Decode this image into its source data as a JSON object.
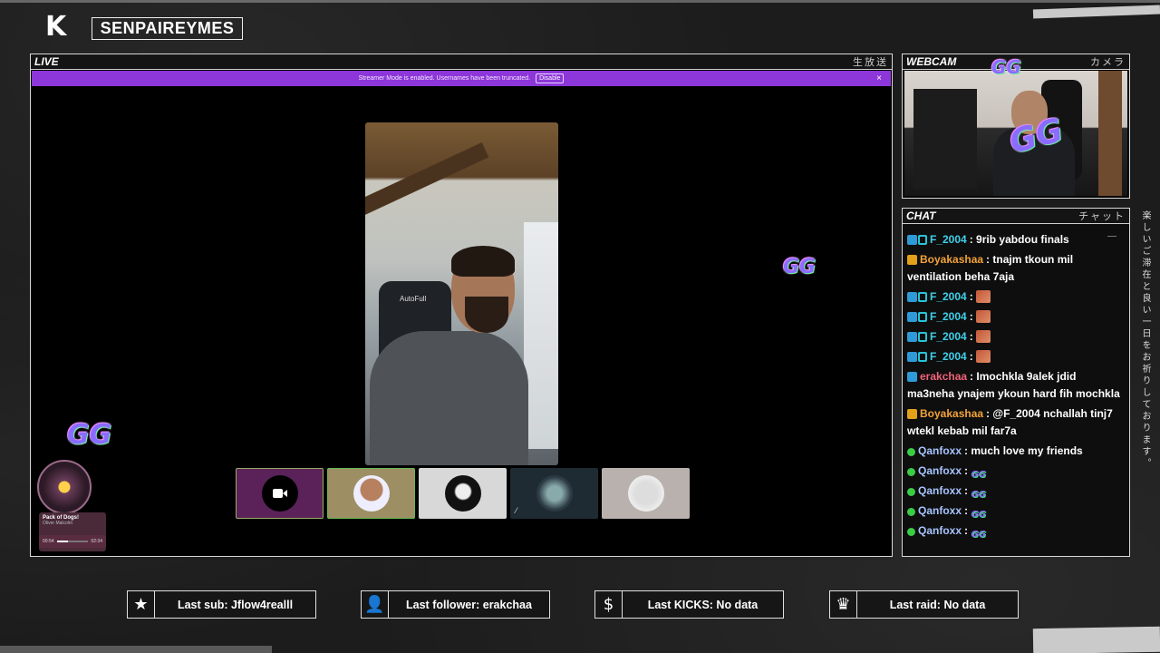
{
  "channel": {
    "name": "SENPAIREYMES"
  },
  "live": {
    "title": "LIVE",
    "jp": "生放送",
    "banner": {
      "text": "Streamer Mode is enabled. Usernames have been truncated.",
      "button": "Disable",
      "close": "×"
    },
    "video": {
      "chair_brand": "AutoFull"
    },
    "music": {
      "title": "Pack of Dogs!",
      "artist": "Oliver Malcolm",
      "elapsed": "00:54",
      "total": "02:34",
      "progress": 0.35
    },
    "gg_label": "GG"
  },
  "webcam": {
    "title": "WEBCAM",
    "jp": "カメラ"
  },
  "chat": {
    "title": "CHAT",
    "jp": "チャット",
    "messages": [
      {
        "user": "F_2004",
        "color": "#3fd0ea",
        "badges": [
          "blue",
          "box"
        ],
        "text": "9rib yabdou finals"
      },
      {
        "user": "Boyakashaa",
        "color": "#f2a33a",
        "badges": [
          "gold"
        ],
        "text": "tnajm tkoun mil ventilation beha 7aja"
      },
      {
        "user": "F_2004",
        "color": "#3fd0ea",
        "badges": [
          "blue",
          "box"
        ],
        "text": "",
        "emote": "photo"
      },
      {
        "user": "F_2004",
        "color": "#3fd0ea",
        "badges": [
          "blue",
          "box"
        ],
        "text": "",
        "emote": "photo"
      },
      {
        "user": "F_2004",
        "color": "#3fd0ea",
        "badges": [
          "blue",
          "box"
        ],
        "text": "",
        "emote": "photo"
      },
      {
        "user": "F_2004",
        "color": "#3fd0ea",
        "badges": [
          "blue",
          "box"
        ],
        "text": "",
        "emote": "photo"
      },
      {
        "user": "erakchaa",
        "color": "#f0637a",
        "badges": [
          "blue"
        ],
        "text": "Imochkla 9alek jdid ma3neha ynajem ykoun hard fih mochkla"
      },
      {
        "user": "Boyakashaa",
        "color": "#f2a33a",
        "badges": [
          "gold"
        ],
        "text": "@F_2004 nchallah tinj7 wtekl kebab mil far7a"
      },
      {
        "user": "Qanfoxx",
        "color": "#a7c4ff",
        "badges": [
          "green"
        ],
        "text": "much love my friends"
      },
      {
        "user": "Qanfoxx",
        "color": "#a7c4ff",
        "badges": [
          "green"
        ],
        "text": "",
        "emote": "gg"
      },
      {
        "user": "Qanfoxx",
        "color": "#a7c4ff",
        "badges": [
          "green"
        ],
        "text": "",
        "emote": "gg"
      },
      {
        "user": "Qanfoxx",
        "color": "#a7c4ff",
        "badges": [
          "green"
        ],
        "text": "",
        "emote": "gg"
      },
      {
        "user": "Qanfoxx",
        "color": "#a7c4ff",
        "badges": [
          "green"
        ],
        "text": "",
        "emote": "gg"
      }
    ]
  },
  "side_jp": "楽しいご滞在と良い一日をお祈りしております。",
  "stats": [
    {
      "icon": "star-icon",
      "glyph": "★",
      "text": "Last sub: Jflow4realll"
    },
    {
      "icon": "add-user-icon",
      "glyph": "👤",
      "text": "Last follower: erakchaa"
    },
    {
      "icon": "dollar-icon",
      "glyph": "$",
      "text": "Last KICKS: No data"
    },
    {
      "icon": "crown-icon",
      "glyph": "♛",
      "text": "Last raid: No data"
    }
  ]
}
